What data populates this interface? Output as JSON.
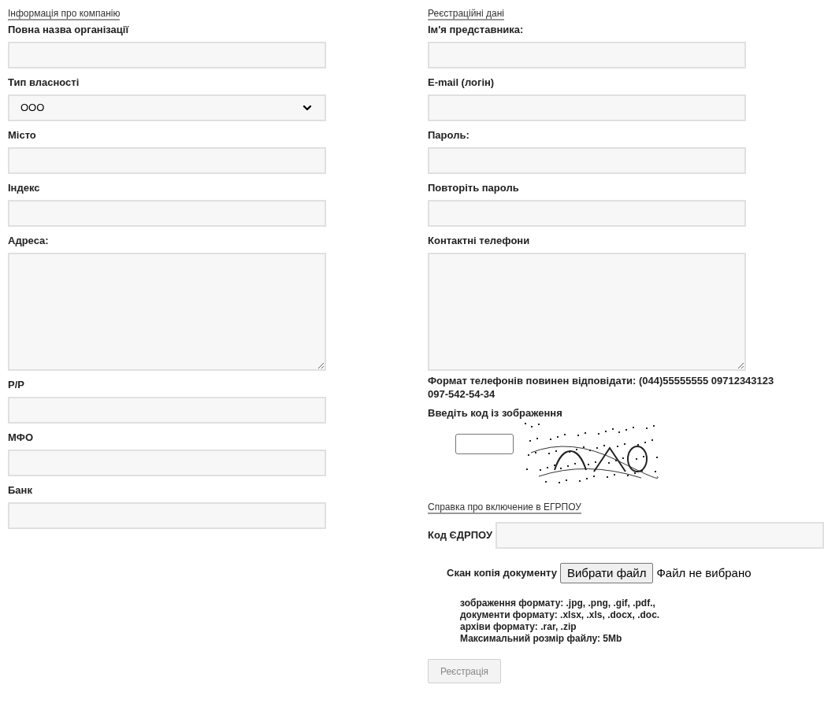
{
  "company": {
    "title": "Інформація про компанію",
    "fields": [
      {
        "kind": "input",
        "label": "Повна назва організації"
      },
      {
        "kind": "select",
        "label": "Тип власності",
        "value": "ООО"
      },
      {
        "kind": "input",
        "label": "Місто"
      },
      {
        "kind": "input",
        "label": "Індекс"
      },
      {
        "kind": "textarea",
        "label": "Адреса:"
      },
      {
        "kind": "input",
        "label": "Р/Р"
      },
      {
        "kind": "input",
        "label": "МФО"
      },
      {
        "kind": "input",
        "label": "Банк"
      }
    ]
  },
  "registration": {
    "title": "Реєстраційні дані",
    "fields": [
      {
        "kind": "input",
        "label": "Ім'я представника:"
      },
      {
        "kind": "input",
        "label": "E-mail (логін)"
      },
      {
        "kind": "input",
        "label": "Пароль:"
      },
      {
        "kind": "input",
        "label": "Повторіть пароль"
      },
      {
        "kind": "textarea",
        "label": "Контактні телефони"
      }
    ],
    "phone_hint": "Формат телефонів повинен відповідати: (044)55555555 09712343123 097-542-54-34",
    "captcha": {
      "label": "Введіть код із зображення"
    }
  },
  "egrpou": {
    "title": "Справка про включение в ЕГРПОУ",
    "code_label": "Код ЄДРПОУ",
    "scan_label": "Скан копія документу",
    "file_button": "Вибрати файл",
    "file_status": "Файл не вибрано",
    "notes": [
      "зображення формату: .jpg, .png, .gif, .pdf.,",
      "документи формату: .xlsx, .xls, .docx, .doc.",
      "архіви формату: .rar, .zip",
      "Максимальний розмір файлу: 5Mb"
    ]
  },
  "submit": {
    "label": "Реєстрація",
    "disabled": true
  }
}
